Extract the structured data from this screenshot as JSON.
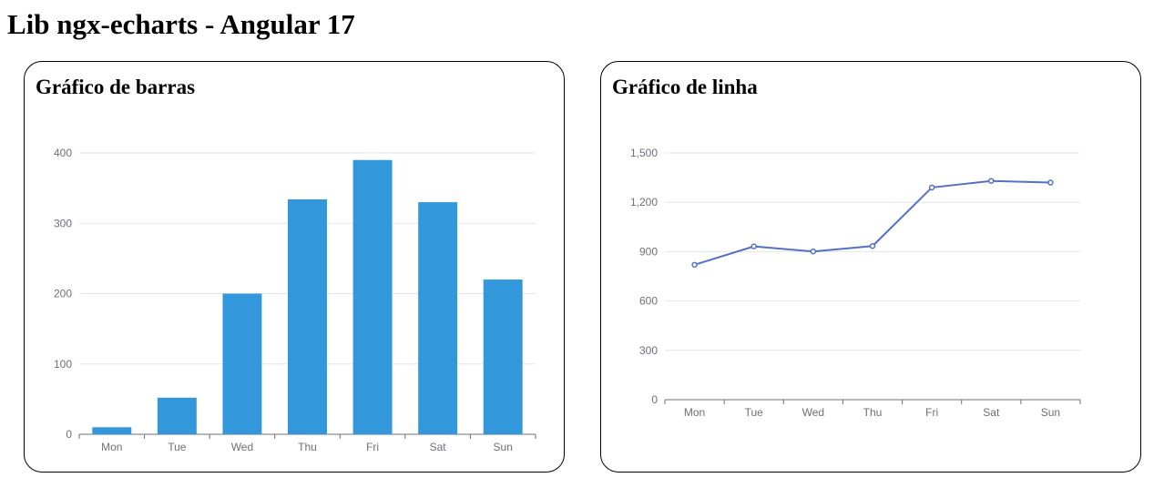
{
  "page": {
    "title": "Lib ngx-echarts - Angular 17"
  },
  "chart_data": [
    {
      "type": "bar",
      "title": "Gráfico de barras",
      "categories": [
        "Mon",
        "Tue",
        "Wed",
        "Thu",
        "Fri",
        "Sat",
        "Sun"
      ],
      "values": [
        10,
        52,
        200,
        334,
        390,
        330,
        220
      ],
      "ylim": [
        0,
        400
      ],
      "yticks": [
        "0",
        "100",
        "200",
        "300",
        "400"
      ],
      "ytick_values": [
        0,
        100,
        200,
        300,
        400
      ],
      "grid": true,
      "color": "#3398db"
    },
    {
      "type": "line",
      "title": "Gráfico de linha",
      "categories": [
        "Mon",
        "Tue",
        "Wed",
        "Thu",
        "Fri",
        "Sat",
        "Sun"
      ],
      "values": [
        820,
        932,
        901,
        934,
        1290,
        1330,
        1320
      ],
      "ylim": [
        0,
        1500
      ],
      "yticks": [
        "0",
        "300",
        "600",
        "900",
        "1,200",
        "1,500"
      ],
      "ytick_values": [
        0,
        300,
        600,
        900,
        1200,
        1500
      ],
      "grid": true,
      "color": "#5470c6"
    }
  ]
}
